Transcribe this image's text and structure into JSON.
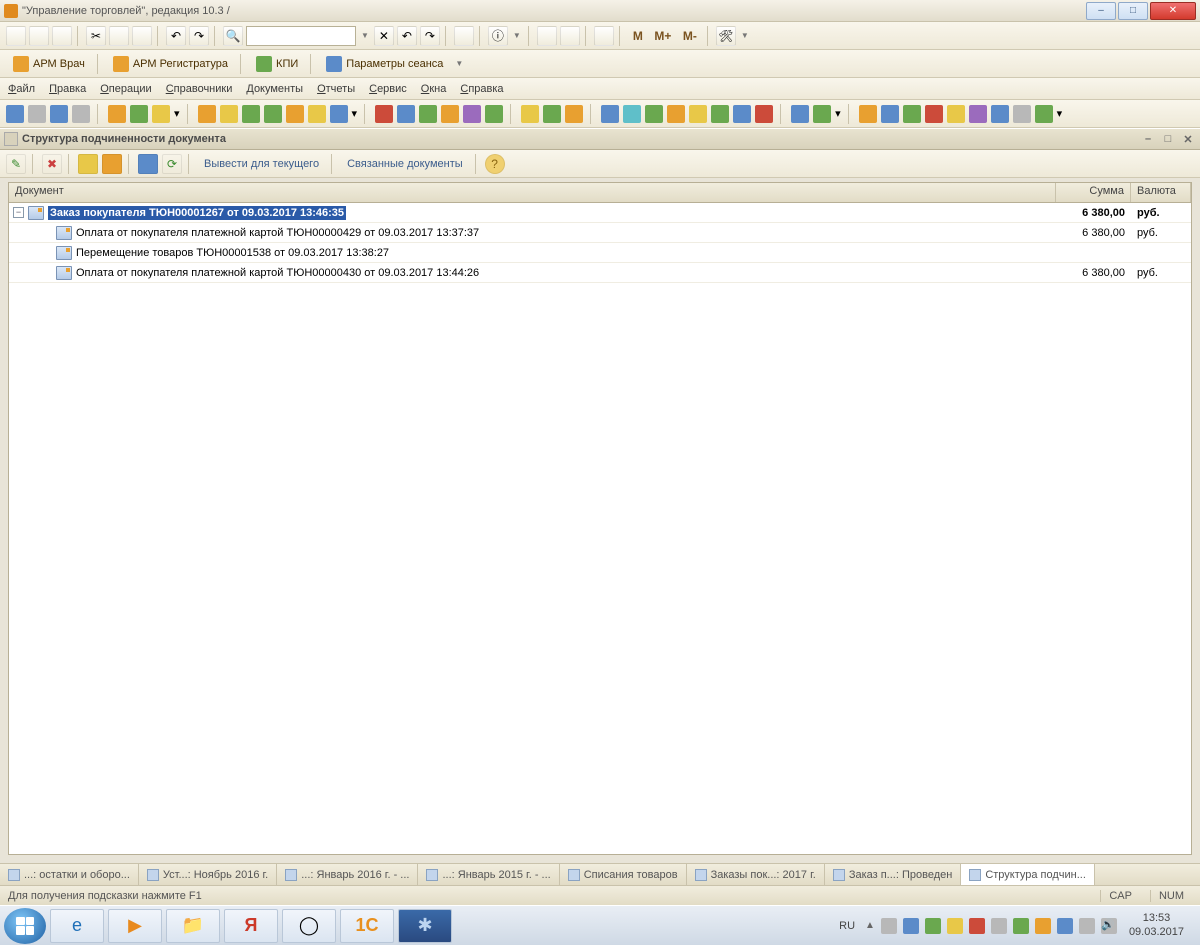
{
  "window": {
    "title": "\"Управление торговлей\", редакция 10.3 /"
  },
  "toolbar1": {
    "search_value": "",
    "mbuttons": [
      "M",
      "M+",
      "M-"
    ]
  },
  "toolbar2": {
    "items": [
      {
        "label": "АРМ Врач"
      },
      {
        "label": "АРМ Регистратура"
      },
      {
        "label": "КПИ"
      },
      {
        "label": "Параметры сеанса"
      }
    ]
  },
  "menu": [
    "Файл",
    "Правка",
    "Операции",
    "Справочники",
    "Документы",
    "Отчеты",
    "Сервис",
    "Окна",
    "Справка"
  ],
  "panel": {
    "title": "Структура подчиненности документа",
    "toolbar": {
      "show_current": "Вывести для текущего",
      "related": "Связанные документы"
    },
    "columns": {
      "doc": "Документ",
      "sum": "Сумма",
      "currency": "Валюта"
    },
    "rows": [
      {
        "level": 0,
        "expanded": true,
        "selected": true,
        "name": "Заказ покупателя ТЮН00001267 от 09.03.2017 13:46:35",
        "sum": "6 380,00",
        "cur": "руб."
      },
      {
        "level": 1,
        "expanded": null,
        "selected": false,
        "name": "Оплата от покупателя платежной картой ТЮН00000429 от 09.03.2017 13:37:37",
        "sum": "6 380,00",
        "cur": "руб."
      },
      {
        "level": 1,
        "expanded": null,
        "selected": false,
        "name": "Перемещение товаров ТЮН00001538 от 09.03.2017 13:38:27",
        "sum": "",
        "cur": ""
      },
      {
        "level": 1,
        "expanded": null,
        "selected": false,
        "name": "Оплата от покупателя платежной картой ТЮН00000430 от 09.03.2017 13:44:26",
        "sum": "6 380,00",
        "cur": "руб."
      }
    ]
  },
  "tabs": [
    "...: остатки и оборо...",
    "Уст...: Ноябрь 2016 г.",
    "...: Январь 2016 г. - ...",
    "...: Январь 2015 г. - ...",
    "Списания товаров",
    "Заказы пок...: 2017 г.",
    "Заказ п...: Проведен",
    "Структура подчин..."
  ],
  "active_tab_index": 7,
  "status": {
    "hint": "Для получения подсказки нажмите F1",
    "cap": "CAP",
    "num": "NUM"
  },
  "taskbar": {
    "lang": "RU",
    "time": "13:53",
    "date": "09.03.2017"
  }
}
